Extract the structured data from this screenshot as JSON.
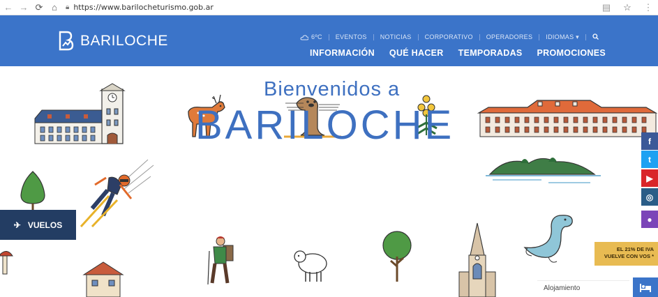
{
  "browser": {
    "url": "https://www.barilocheturismo.gob.ar"
  },
  "header": {
    "logo_text": "BARILOCHE",
    "weather": "6ºC",
    "utility_nav": [
      "EVENTOS",
      "NOTICIAS",
      "CORPORATIVO",
      "OPERADORES",
      "IDIOMAS ▾"
    ],
    "main_nav": [
      "INFORMACIÓN",
      "QUÉ HACER",
      "TEMPORADAS",
      "PROMOCIONES"
    ]
  },
  "hero": {
    "welcome": "Bienvenidos a",
    "title": "BARILOCHE"
  },
  "vuelos": {
    "label": "VUELOS"
  },
  "social": [
    {
      "icon": "facebook-icon",
      "glyph": "f",
      "color": "#3b5998"
    },
    {
      "icon": "twitter-icon",
      "glyph": "t",
      "color": "#1da1f2"
    },
    {
      "icon": "youtube-icon",
      "glyph": "▶",
      "color": "#d9252a"
    },
    {
      "icon": "instagram-icon",
      "glyph": "◎",
      "color": "#2a5d87"
    },
    {
      "icon": "flickr-icon",
      "glyph": "●",
      "color": "#7b45b8"
    }
  ],
  "promo": {
    "line1": "EL 21% DE IVA",
    "line2": "VUELVE CON VOS *"
  },
  "lodging": {
    "label": "Alojamiento"
  },
  "colors": {
    "brand_blue": "#3b74c9",
    "title_blue": "#3e70c0",
    "vuelos_bg": "#233d63",
    "promo_bg": "#e8bb52"
  }
}
